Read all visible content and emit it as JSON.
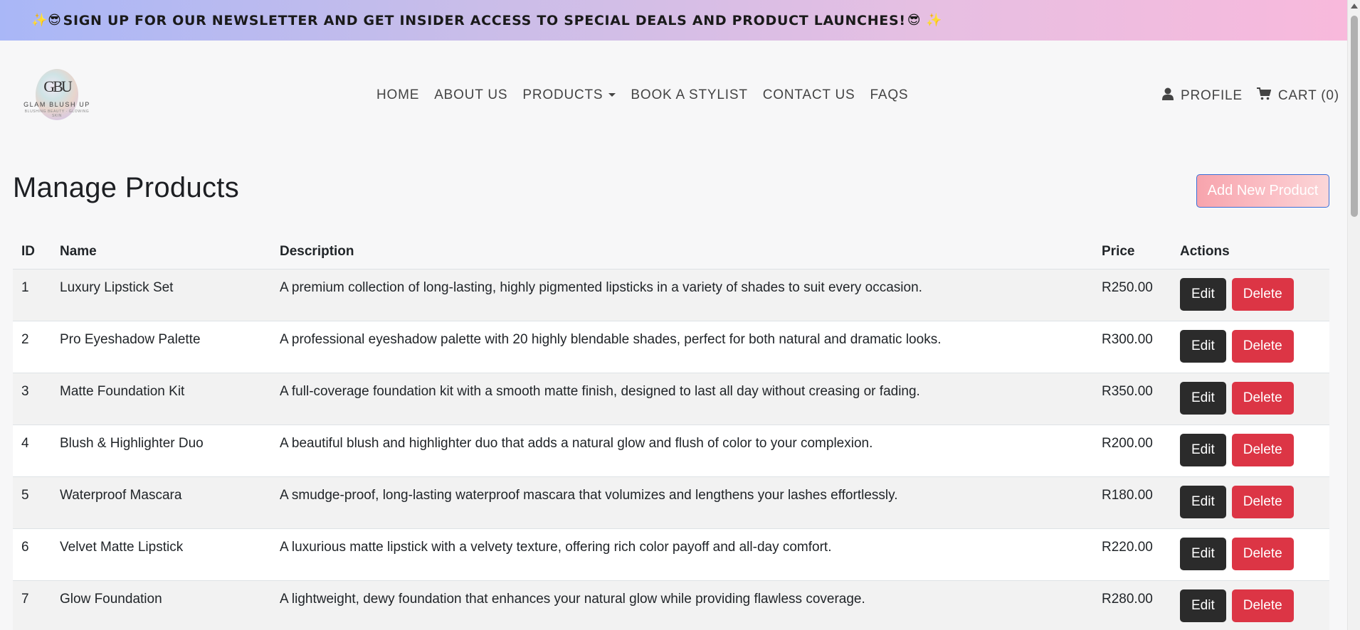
{
  "banner": {
    "emoji_left": "✨😎",
    "text": "SIGN UP FOR OUR NEWSLETTER AND GET INSIDER ACCESS TO SPECIAL DEALS AND PRODUCT LAUNCHES!",
    "emoji_right": "😎 ✨"
  },
  "logo": {
    "monogram": "GBU",
    "name": "GLAM BLUSH UP",
    "tagline": "BLUSHING BEAUTY · GLOWING SKIN"
  },
  "nav": {
    "links": [
      "HOME",
      "ABOUT US",
      "PRODUCTS",
      "BOOK A STYLIST",
      "CONTACT US",
      "FAQS"
    ],
    "profile": "PROFILE",
    "cart": "CART (0)"
  },
  "page": {
    "title": "Manage Products",
    "add_button": "Add New Product"
  },
  "table": {
    "headers": [
      "ID",
      "Name",
      "Description",
      "Price",
      "Actions"
    ],
    "edit_label": "Edit",
    "delete_label": "Delete",
    "rows": [
      {
        "id": "1",
        "name": "Luxury Lipstick Set",
        "description": "A premium collection of long-lasting, highly pigmented lipsticks in a variety of shades to suit every occasion.",
        "price": "R250.00"
      },
      {
        "id": "2",
        "name": "Pro Eyeshadow Palette",
        "description": "A professional eyeshadow palette with 20 highly blendable shades, perfect for both natural and dramatic looks.",
        "price": "R300.00"
      },
      {
        "id": "3",
        "name": "Matte Foundation Kit",
        "description": "A full-coverage foundation kit with a smooth matte finish, designed to last all day without creasing or fading.",
        "price": "R350.00"
      },
      {
        "id": "4",
        "name": "Blush & Highlighter Duo",
        "description": "A beautiful blush and highlighter duo that adds a natural glow and flush of color to your complexion.",
        "price": "R200.00"
      },
      {
        "id": "5",
        "name": "Waterproof Mascara",
        "description": "A smudge-proof, long-lasting waterproof mascara that volumizes and lengthens your lashes effortlessly.",
        "price": "R180.00"
      },
      {
        "id": "6",
        "name": "Velvet Matte Lipstick",
        "description": "A luxurious matte lipstick with a velvety texture, offering rich color payoff and all-day comfort.",
        "price": "R220.00"
      },
      {
        "id": "7",
        "name": "Glow Foundation",
        "description": "A lightweight, dewy foundation that enhances your natural glow while providing flawless coverage.",
        "price": "R280.00"
      }
    ]
  },
  "colors": {
    "delete": "#dc3545",
    "edit": "#2b2b2b",
    "add_button_border": "#3a6fd8"
  }
}
